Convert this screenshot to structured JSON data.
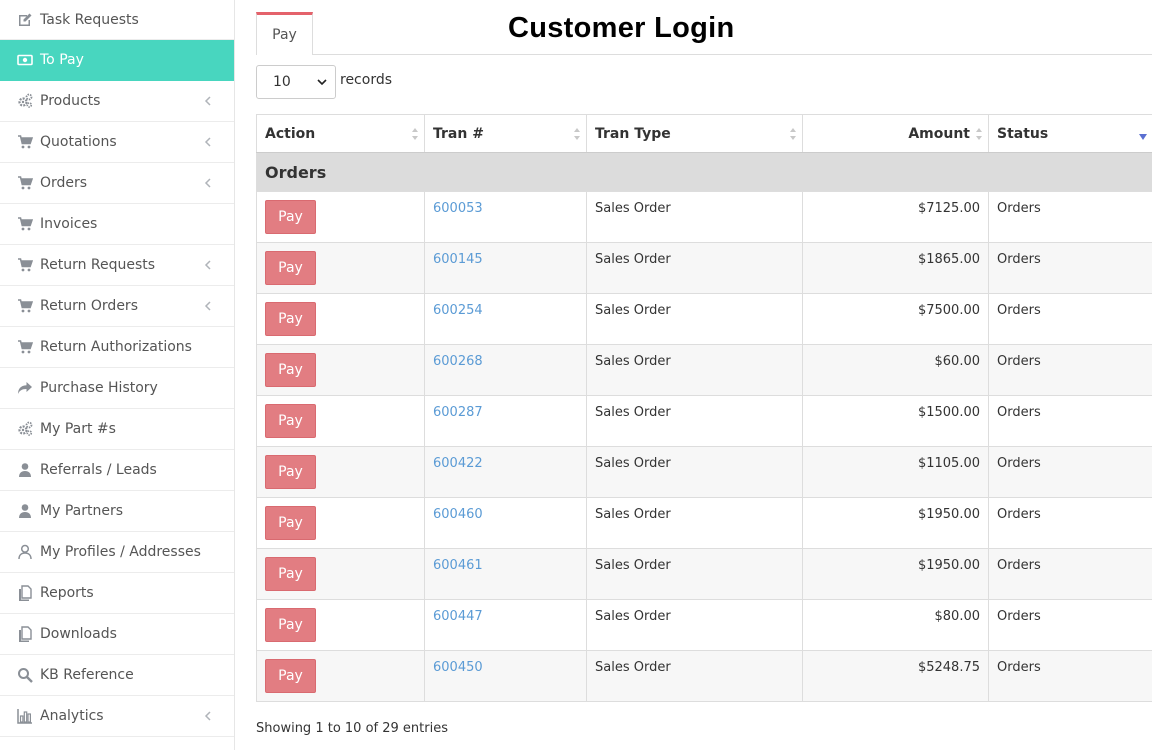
{
  "sidebar": {
    "items": [
      {
        "label": "Task Requests",
        "icon": "edit-icon",
        "chevron": false,
        "active": false
      },
      {
        "label": "To Pay",
        "icon": "money-icon",
        "chevron": false,
        "active": true
      },
      {
        "label": "Products",
        "icon": "cogs-icon",
        "chevron": true,
        "active": false
      },
      {
        "label": "Quotations",
        "icon": "cart-icon",
        "chevron": true,
        "active": false
      },
      {
        "label": "Orders",
        "icon": "cart-icon",
        "chevron": true,
        "active": false
      },
      {
        "label": "Invoices",
        "icon": "cart-icon",
        "chevron": false,
        "active": false
      },
      {
        "label": "Return Requests",
        "icon": "cart-icon",
        "chevron": true,
        "active": false
      },
      {
        "label": "Return Orders",
        "icon": "cart-icon",
        "chevron": true,
        "active": false
      },
      {
        "label": "Return Authorizations",
        "icon": "cart-icon",
        "chevron": false,
        "active": false
      },
      {
        "label": "Purchase History",
        "icon": "share-icon",
        "chevron": false,
        "active": false
      },
      {
        "label": "My Part #s",
        "icon": "cogs-icon",
        "chevron": false,
        "active": false
      },
      {
        "label": "Referrals / Leads",
        "icon": "user-icon",
        "chevron": false,
        "active": false
      },
      {
        "label": "My Partners",
        "icon": "user-icon",
        "chevron": false,
        "active": false
      },
      {
        "label": "My Profiles / Addresses",
        "icon": "user-outline-icon",
        "chevron": false,
        "active": false
      },
      {
        "label": "Reports",
        "icon": "copy-icon",
        "chevron": false,
        "active": false
      },
      {
        "label": "Downloads",
        "icon": "copy-icon",
        "chevron": false,
        "active": false
      },
      {
        "label": "KB Reference",
        "icon": "search-icon",
        "chevron": false,
        "active": false
      },
      {
        "label": "Analytics",
        "icon": "bar-chart-icon",
        "chevron": true,
        "active": false
      }
    ]
  },
  "tabs": [
    {
      "label": "Pay"
    }
  ],
  "page_title": "Customer Login",
  "length": {
    "selected": "10",
    "label": "records"
  },
  "table": {
    "columns": [
      "Action",
      "Tran #",
      "Tran Type",
      "Amount",
      "Status"
    ],
    "group_label": "Orders",
    "pay_label": "Pay",
    "rows": [
      {
        "tran": "600053",
        "type": "Sales Order",
        "amount": "$7125.00",
        "status": "Orders"
      },
      {
        "tran": "600145",
        "type": "Sales Order",
        "amount": "$1865.00",
        "status": "Orders"
      },
      {
        "tran": "600254",
        "type": "Sales Order",
        "amount": "$7500.00",
        "status": "Orders"
      },
      {
        "tran": "600268",
        "type": "Sales Order",
        "amount": "$60.00",
        "status": "Orders"
      },
      {
        "tran": "600287",
        "type": "Sales Order",
        "amount": "$1500.00",
        "status": "Orders"
      },
      {
        "tran": "600422",
        "type": "Sales Order",
        "amount": "$1105.00",
        "status": "Orders"
      },
      {
        "tran": "600460",
        "type": "Sales Order",
        "amount": "$1950.00",
        "status": "Orders"
      },
      {
        "tran": "600461",
        "type": "Sales Order",
        "amount": "$1950.00",
        "status": "Orders"
      },
      {
        "tran": "600447",
        "type": "Sales Order",
        "amount": "$80.00",
        "status": "Orders"
      },
      {
        "tran": "600450",
        "type": "Sales Order",
        "amount": "$5248.75",
        "status": "Orders"
      }
    ]
  },
  "info": "Showing 1 to 10 of 29 entries",
  "colors": {
    "accent": "#48d6bf",
    "pay_button": "#e27d82",
    "link": "#5b9bd5",
    "tab_top": "#e4626b",
    "sort_active": "#5a6fd1"
  }
}
